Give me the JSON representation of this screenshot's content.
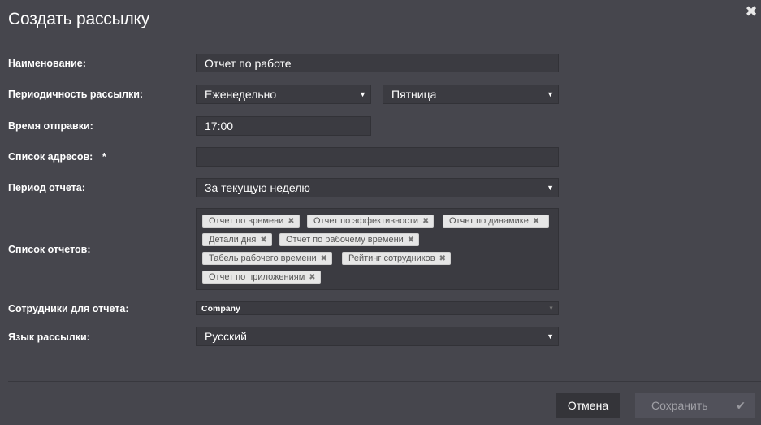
{
  "dialog": {
    "title": "Создать рассылку",
    "close_icon": "close-icon"
  },
  "form": {
    "name": {
      "label": "Наименование:",
      "value": "Отчет по работе"
    },
    "periodicity": {
      "label": "Периодичность рассылки:",
      "frequency": "Еженедельно",
      "day": "Пятница"
    },
    "send_time": {
      "label": "Время отправки:",
      "value": "17:00"
    },
    "addresses": {
      "label": "Список адресов:",
      "required_mark": "*",
      "value": ""
    },
    "report_period": {
      "label": "Период отчета:",
      "value": "За текущую неделю"
    },
    "reports": {
      "label": "Список отчетов:",
      "tags": [
        "Отчет по времени",
        "Отчет по эффективности",
        "Отчет по динамике",
        "Детали дня",
        "Отчет по рабочему времени",
        "Табель рабочего времени",
        "Рейтинг сотрудников",
        "Отчет по приложениям"
      ]
    },
    "employees": {
      "label": "Сотрудники для отчета:",
      "value": "Company"
    },
    "language": {
      "label": "Язык рассылки:",
      "value": "Русский"
    }
  },
  "footer": {
    "cancel_label": "Отмена",
    "save_label": "Сохранить",
    "save_icon": "check-icon"
  }
}
